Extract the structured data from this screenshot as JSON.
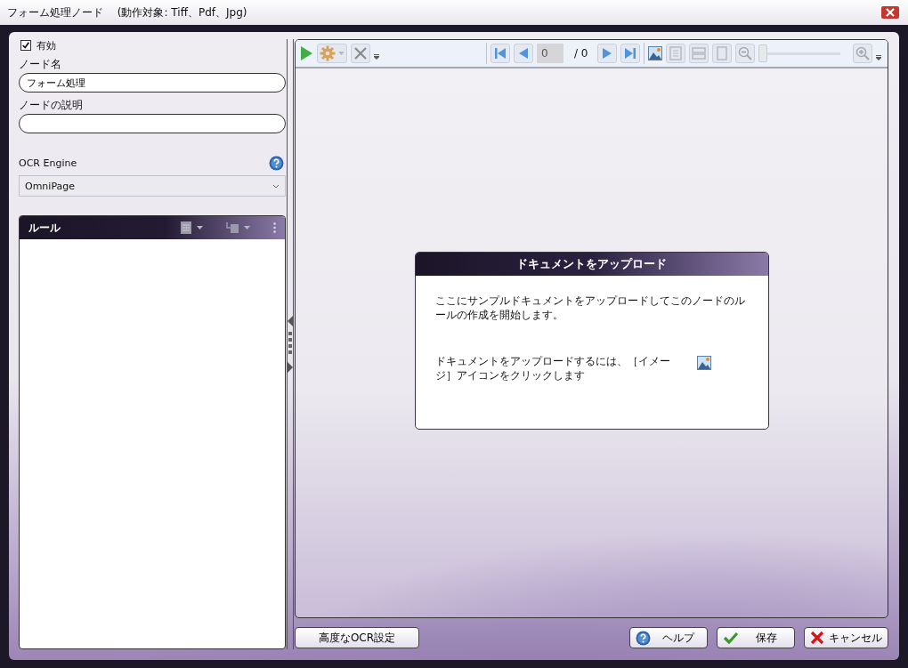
{
  "window": {
    "title": "フォーム処理ノード　 (動作対象: Tiff、Pdf、Jpg)"
  },
  "enabled": {
    "label": "有効",
    "checked": true
  },
  "node_name": {
    "label": "ノード名",
    "value": "フォーム処理"
  },
  "node_description": {
    "label": "ノードの説明"
  },
  "ocr_engine": {
    "label": "OCR Engine",
    "value": "OmniPage"
  },
  "rules_panel": {
    "title": "ルール"
  },
  "viewer": {
    "page": "0",
    "total": "/ 0",
    "zoom": {
      "level": 0
    }
  },
  "upload_card": {
    "title": "ドキュメントをアップロード",
    "message": "ここにサンプルドキュメントをアップロードしてこのノードのルールの作成を開始します。",
    "instruction": "ドキュメントをアップロードするには、［イメージ］アイコンをクリックします"
  },
  "buttons": [
    {
      "label": "高度なOCR設定",
      "kind": "plain"
    },
    {
      "label": "ヘルプ",
      "kind": "help"
    },
    {
      "label": "保存",
      "kind": "save"
    },
    {
      "label": "キャンセル",
      "kind": "cancel"
    }
  ]
}
